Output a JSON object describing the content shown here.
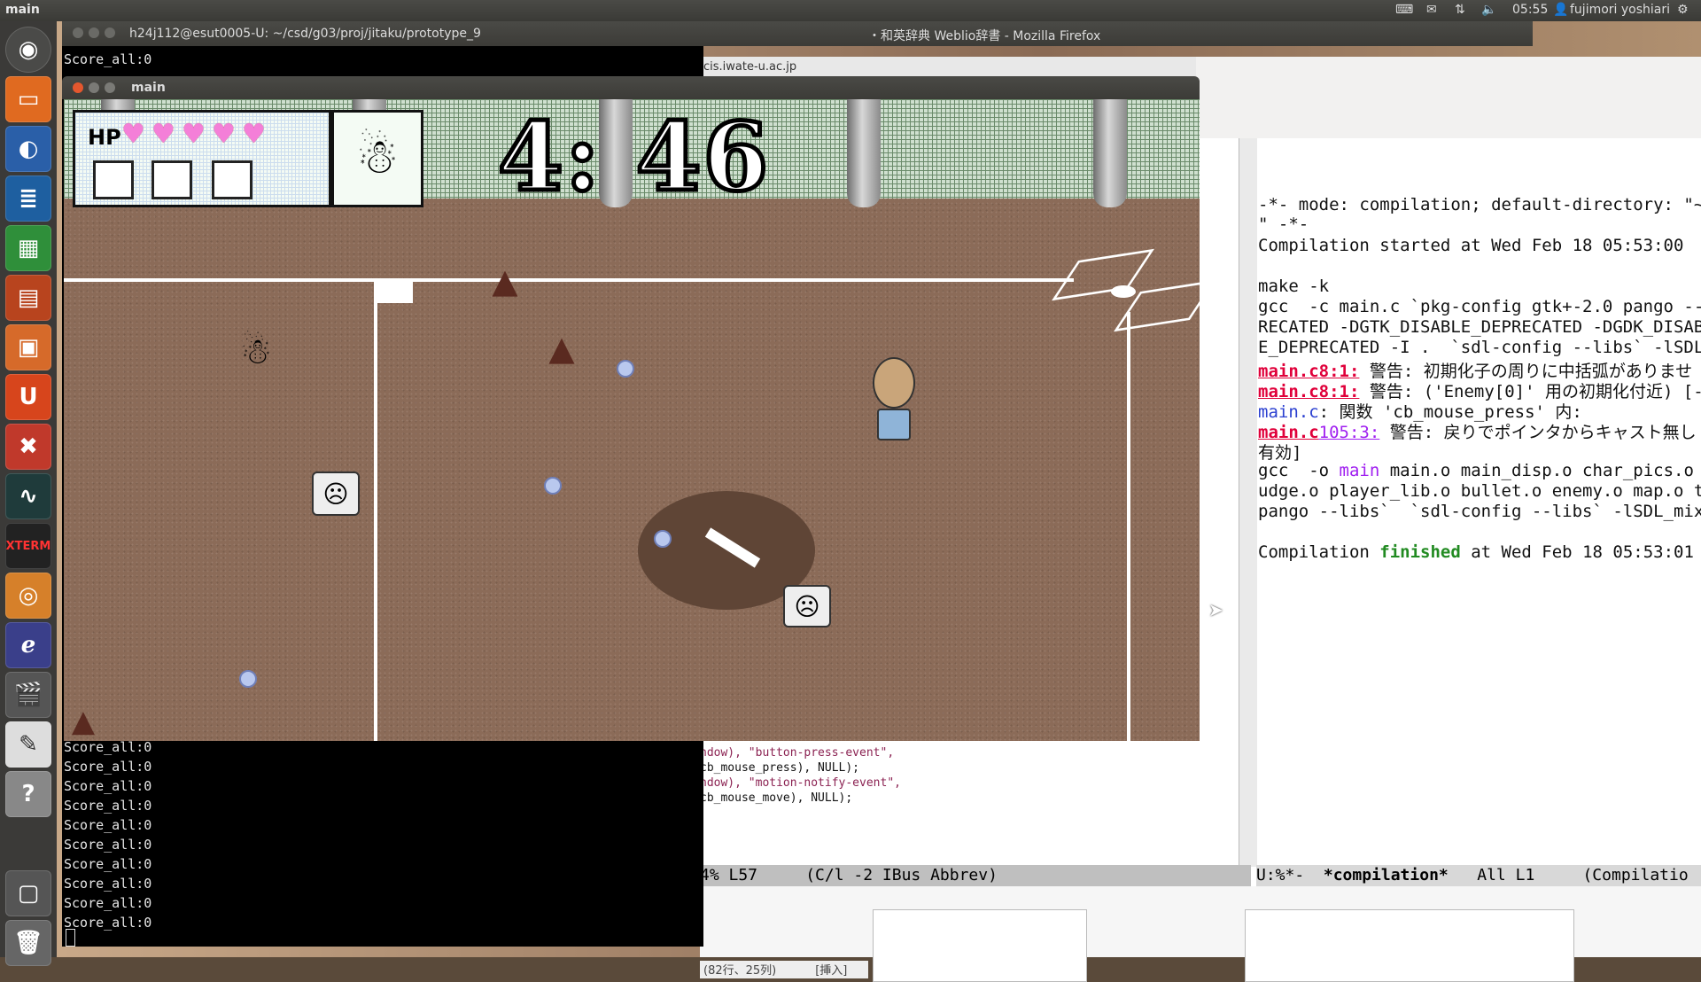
{
  "top_panel": {
    "app_title": "main",
    "time": "05:55",
    "user": "fujimori yoshiari"
  },
  "launcher_icons": [
    "dash-home-icon",
    "files-icon",
    "firefox-icon",
    "writer-icon",
    "calc-icon",
    "impress-icon",
    "software-center-icon",
    "ubuntu-one-icon",
    "system-settings-icon",
    "system-monitor-icon",
    "xterm-icon",
    "shotwell-icon",
    "emacs-icon",
    "video-editor-icon",
    "text-editor-icon",
    "help-icon",
    "workspace-switcher-icon",
    "trash-icon"
  ],
  "terminal": {
    "title": "h24j112@esut0005-U: ~/csd/g03/proj/jitaku/prototype_9",
    "top_line": "Score_all:0",
    "lines": [
      "Score_all:0",
      "Score_all:0",
      "Score_all:0",
      "Score_all:0",
      "Score_all:0",
      "Score_all:0",
      "Score_all:0",
      "Score_all:0",
      "Score_all:0",
      "Score_all:0"
    ]
  },
  "firefox": {
    "title": "・和英辞典 Weblio辞書 - Mozilla Firefox",
    "url_fragment": "cis.iwate-u.ac.jp"
  },
  "game": {
    "window_title": "main",
    "hp_label": "HP",
    "hearts": 5,
    "timer": "4: 46"
  },
  "emacs": {
    "compilation_lines": [
      "-*- mode: compilation; default-directory: \"~/",
      "\" -*-",
      "Compilation started at Wed Feb 18 05:53:00",
      "",
      "make -k",
      "gcc  -c main.c `pkg-config gtk+-2.0 pango --c",
      "RECATED -DGTK_DISABLE_DEPRECATED -DGDK_DISABL",
      "E_DEPRECATED -I .  `sdl-config --libs` -lSDL_"
    ],
    "warn1": {
      "file": "main.c",
      "loc": "8:1:",
      "msg": " 警告: 初期化子の周りに中括弧がありませ"
    },
    "warn2": {
      "file": "main.c",
      "loc": "8:1:",
      "msg": " 警告: ('Enemy[0]' 用の初期化付近) [-"
    },
    "func_line": {
      "file": "main.c",
      "msg": ": 関数 'cb_mouse_press' 内:"
    },
    "warn3": {
      "file": "main.c",
      "loc": "105:3:",
      "msg": " 警告: 戻りでポインタからキャスト無し"
    },
    "after_lines": [
      "有効]",
      "gcc  -o ",
      "udge.o player_lib.o bullet.o enemy.o map.o ti",
      "pango --libs`  `sdl-config --libs` -lSDL_mixe"
    ],
    "gcc_target": "main",
    "gcc_rest": " main.o main_disp.o char_pics.o g",
    "finished_prefix": "Compilation ",
    "finished_word": "finished",
    "finished_suffix": " at Wed Feb 18 05:53:01",
    "source_lines": [
      "ndow), \"button-press-event\",",
      "cb_mouse_press), NULL);",
      "ndow), \"motion-notify-event\",",
      "cb_mouse_move), NULL);"
    ],
    "modeline_left": "4% L57     (C/l -2 IBus Abbrev)",
    "modeline_right_status": "U:%*-  ",
    "modeline_right_buffer": "*compilation*",
    "modeline_right_rest": "   All L1     (Compilatio"
  },
  "editor_status": {
    "position": "(82行、25列)",
    "mode": "[挿入]"
  }
}
